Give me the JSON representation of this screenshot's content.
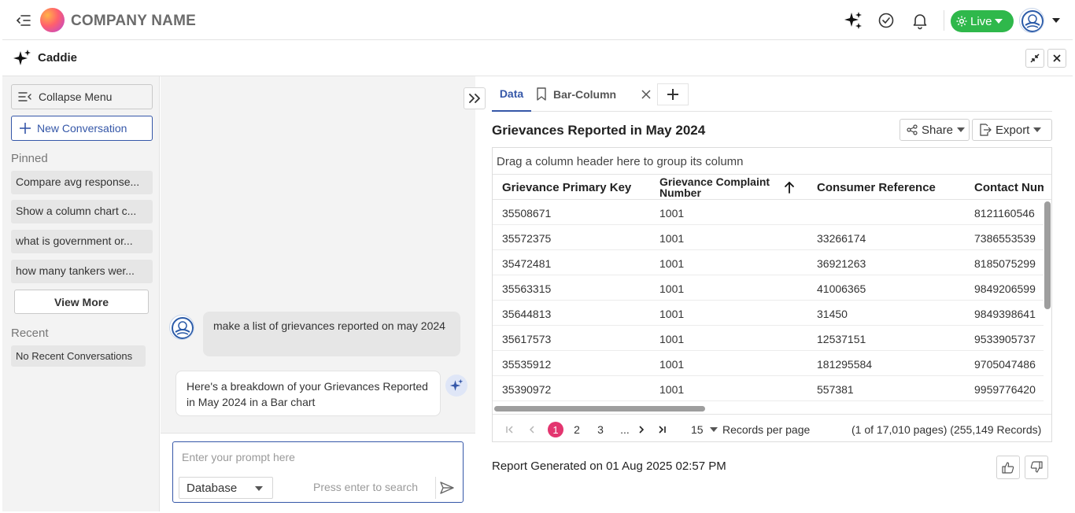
{
  "header": {
    "company_name": "COMPANY NAME",
    "live_label": "Live",
    "live_color": "#2fb84b"
  },
  "caddie": {
    "title": "Caddie"
  },
  "sidebar": {
    "collapse_label": "Collapse Menu",
    "new_conversation_label": "New Conversation",
    "pinned_label": "Pinned",
    "pinned_items": [
      {
        "label": "Compare avg response..."
      },
      {
        "label": "Show a column chart c..."
      },
      {
        "label": "what is government or..."
      },
      {
        "label": "how many tankers wer..."
      }
    ],
    "view_more_label": "View More",
    "recent_label": "Recent",
    "recent_empty": "No Recent Conversations"
  },
  "chat": {
    "user_message": "make a list of grievances reported on may 2024",
    "bot_message": "Here's a breakdown of your Grievances Reported in May 2024 in a Bar chart",
    "prompt_placeholder": "Enter your prompt here",
    "source_select": "Database",
    "search_hint": "Press enter to search"
  },
  "report": {
    "tabs": [
      {
        "label": "Data"
      },
      {
        "label": "Bar-Column"
      }
    ],
    "title": "Grievances Reported in May 2024",
    "share_label": "Share",
    "export_label": "Export",
    "group_hint": "Drag a column header here to group its column",
    "columns": [
      "Grievance Primary Key",
      "Grievance Complaint Number",
      "Consumer Reference",
      "Contact Num"
    ],
    "rows": [
      [
        "35508671",
        "1001",
        "",
        "8121160546"
      ],
      [
        "35572375",
        "1001",
        "33266174",
        "7386553539"
      ],
      [
        "35472481",
        "1001",
        "36921263",
        "8185075299"
      ],
      [
        "35563315",
        "1001",
        "41006365",
        "9849206599"
      ],
      [
        "35644813",
        "1001",
        "31450",
        "9849398641"
      ],
      [
        "35617573",
        "1001",
        "12537151",
        "9533905737"
      ],
      [
        "35535912",
        "1001",
        "181295584",
        "9705047486"
      ],
      [
        "35390972",
        "1001",
        "557381",
        "9959776420"
      ]
    ],
    "pager": {
      "pages": [
        "1",
        "2",
        "3",
        "..."
      ],
      "current_page": "1",
      "page_size": "15",
      "records_label": "Records per page",
      "summary": "(1 of 17,010 pages) (255,149 Records)"
    },
    "generated_text": "Report Generated on 01 Aug 2025 02:57 PM",
    "accent_color": "#3557a8",
    "active_page_color": "#e3356f"
  }
}
